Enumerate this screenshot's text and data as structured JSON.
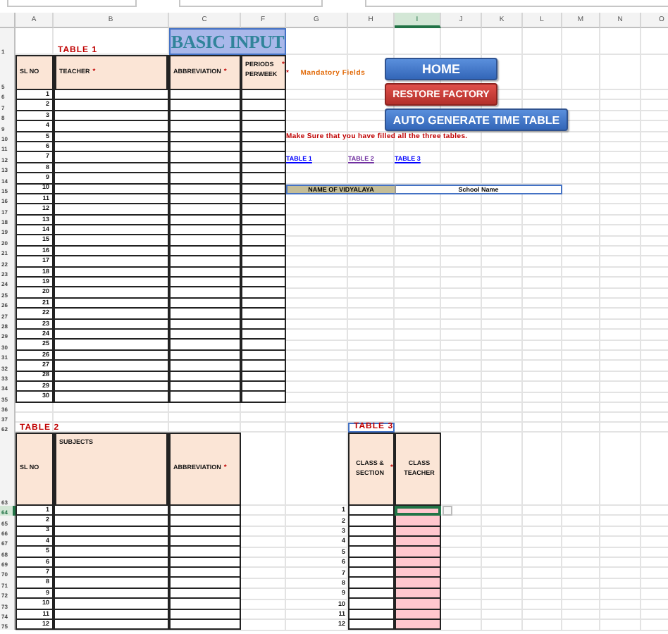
{
  "columns": [
    {
      "label": "A",
      "selected": false
    },
    {
      "label": "B",
      "selected": false
    },
    {
      "label": "C",
      "selected": false
    },
    {
      "label": "F",
      "selected": false
    },
    {
      "label": "G",
      "selected": false
    },
    {
      "label": "H",
      "selected": false
    },
    {
      "label": "I",
      "selected": true
    },
    {
      "label": "J",
      "selected": false
    },
    {
      "label": "K",
      "selected": false
    },
    {
      "label": "L",
      "selected": false
    },
    {
      "label": "M",
      "selected": false
    },
    {
      "label": "N",
      "selected": false
    },
    {
      "label": "O",
      "selected": false
    }
  ],
  "rows": [
    {
      "label": "1",
      "selected": false
    },
    {
      "label": "5",
      "selected": false
    },
    {
      "label": "6",
      "selected": false
    },
    {
      "label": "7",
      "selected": false
    },
    {
      "label": "8",
      "selected": false
    },
    {
      "label": "9",
      "selected": false
    },
    {
      "label": "10",
      "selected": false
    },
    {
      "label": "11",
      "selected": false
    },
    {
      "label": "12",
      "selected": false
    },
    {
      "label": "13",
      "selected": false
    },
    {
      "label": "14",
      "selected": false
    },
    {
      "label": "15",
      "selected": false
    },
    {
      "label": "16",
      "selected": false
    },
    {
      "label": "17",
      "selected": false
    },
    {
      "label": "18",
      "selected": false
    },
    {
      "label": "19",
      "selected": false
    },
    {
      "label": "20",
      "selected": false
    },
    {
      "label": "21",
      "selected": false
    },
    {
      "label": "22",
      "selected": false
    },
    {
      "label": "23",
      "selected": false
    },
    {
      "label": "24",
      "selected": false
    },
    {
      "label": "25",
      "selected": false
    },
    {
      "label": "26",
      "selected": false
    },
    {
      "label": "27",
      "selected": false
    },
    {
      "label": "28",
      "selected": false
    },
    {
      "label": "29",
      "selected": false
    },
    {
      "label": "30",
      "selected": false
    },
    {
      "label": "31",
      "selected": false
    },
    {
      "label": "32",
      "selected": false
    },
    {
      "label": "33",
      "selected": false
    },
    {
      "label": "34",
      "selected": false
    },
    {
      "label": "35",
      "selected": false
    },
    {
      "label": "36",
      "selected": false
    },
    {
      "label": "37",
      "selected": false
    },
    {
      "label": "62",
      "selected": false
    },
    {
      "label": "63",
      "selected": false
    },
    {
      "label": "64",
      "selected": true
    },
    {
      "label": "65",
      "selected": false
    },
    {
      "label": "66",
      "selected": false
    },
    {
      "label": "67",
      "selected": false
    },
    {
      "label": "68",
      "selected": false
    },
    {
      "label": "69",
      "selected": false
    },
    {
      "label": "70",
      "selected": false
    },
    {
      "label": "71",
      "selected": false
    },
    {
      "label": "72",
      "selected": false
    },
    {
      "label": "73",
      "selected": false
    },
    {
      "label": "74",
      "selected": false
    },
    {
      "label": "75",
      "selected": false
    }
  ],
  "banner": "BASIC INPUT",
  "table_1": {
    "caption": "TABLE 1",
    "columns": [
      {
        "label": "SL NO"
      },
      {
        "label": "TEACHER",
        "mark": "*"
      },
      {
        "label": "ABBREVIATION",
        "mark": "*"
      },
      {
        "label": "PERIODS PERWEEK",
        "mark": "*"
      }
    ],
    "serials": [
      "1",
      "2",
      "3",
      "4",
      "5",
      "6",
      "7",
      "8",
      "9",
      "10",
      "11",
      "12",
      "13",
      "14",
      "15",
      "16",
      "17",
      "18",
      "19",
      "20",
      "21",
      "22",
      "23",
      "24",
      "25",
      "26",
      "27",
      "28",
      "29",
      "30"
    ]
  },
  "legend": {
    "mark": "*",
    "text": "Mandatory Fields"
  },
  "buttons": [
    {
      "label": "HOME",
      "kind": "primary"
    },
    {
      "label": "RESTORE FACTORY",
      "kind": "danger"
    },
    {
      "label": "AUTO GENERATE TIME TABLE",
      "kind": "primary"
    }
  ],
  "notice": "Make Sure that you have filled all the three tables.",
  "links": [
    {
      "label": "TABLE 1",
      "visited": false
    },
    {
      "label": "TABLE 2",
      "visited": true
    },
    {
      "label": "TABLE 3",
      "visited": false
    }
  ],
  "school": {
    "label": "NAME OF VIDYALAYA",
    "value": "School Name"
  },
  "table_2": {
    "caption": "TABLE 2",
    "columns": [
      {
        "label": "SL NO"
      },
      {
        "label": "SUBJECTS"
      },
      {
        "label": "ABBREVIATION",
        "mark": "*"
      }
    ],
    "serials": [
      "1",
      "2",
      "3",
      "4",
      "5",
      "6",
      "7",
      "8",
      "9",
      "10",
      "11",
      "12"
    ]
  },
  "table_3": {
    "caption": "TABLE 3",
    "columns": [
      {
        "label": "CLASS & SECTION",
        "mark": "*"
      },
      {
        "label": "CLASS TEACHER"
      }
    ],
    "rows": [
      {
        "serial": "1",
        "selected": true
      },
      {
        "serial": "2",
        "selected": false
      },
      {
        "serial": "3",
        "selected": false
      },
      {
        "serial": "4",
        "selected": false
      },
      {
        "serial": "5",
        "selected": false
      },
      {
        "serial": "6",
        "selected": false
      },
      {
        "serial": "7",
        "selected": false
      },
      {
        "serial": "8",
        "selected": false
      },
      {
        "serial": "9",
        "selected": false
      },
      {
        "serial": "10",
        "selected": false
      },
      {
        "serial": "11",
        "selected": false
      },
      {
        "serial": "12",
        "selected": false
      }
    ]
  }
}
